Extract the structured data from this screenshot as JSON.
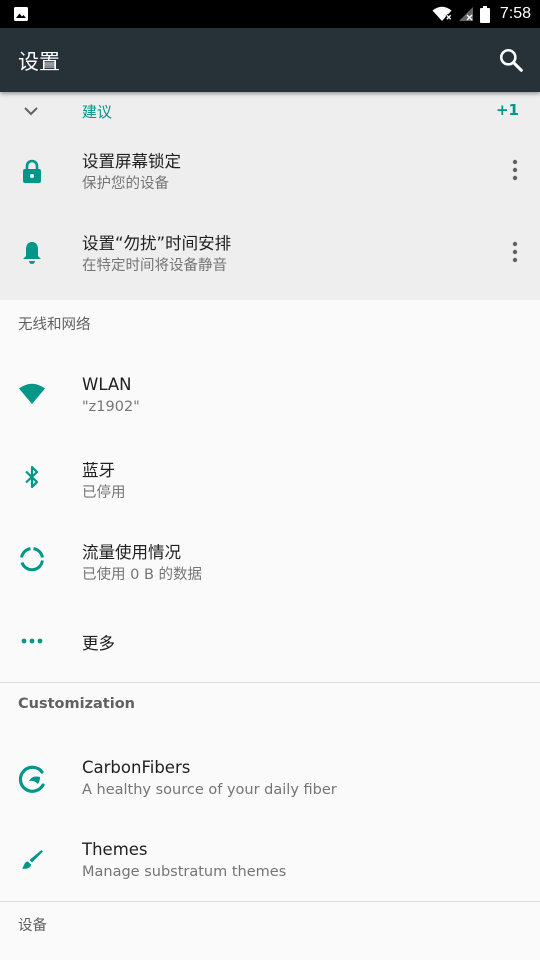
{
  "status_bar": {
    "time": "7:58",
    "icons": [
      "image-icon",
      "wifi-icon",
      "no-signal-icon",
      "battery-icon"
    ]
  },
  "toolbar": {
    "title": "设置",
    "search_icon": "search-icon"
  },
  "suggestions": {
    "label": "建议",
    "count": "+1",
    "items": [
      {
        "title": "设置屏幕锁定",
        "summary": "保护您的设备",
        "icon": "lock-icon"
      },
      {
        "title": "设置“勿扰”时间安排",
        "summary": "在特定时间将设备静音",
        "icon": "bell-icon"
      }
    ]
  },
  "sections": [
    {
      "title": "无线和网络",
      "items": [
        {
          "title": "WLAN",
          "summary": "\"z1902\"",
          "icon": "wifi-icon"
        },
        {
          "title": "蓝牙",
          "summary": "已停用",
          "icon": "bluetooth-icon"
        },
        {
          "title": "流量使用情况",
          "summary": "已使用 0 B 的数据",
          "icon": "data-usage-icon"
        },
        {
          "title": "更多",
          "summary": "",
          "icon": "more-horizontal-icon"
        }
      ]
    },
    {
      "title": "Customization",
      "items": [
        {
          "title": "CarbonFibers",
          "summary": "A healthy source of your daily fiber",
          "icon": "carbonfibers-icon"
        },
        {
          "title": "Themes",
          "summary": "Manage substratum themes",
          "icon": "brush-icon"
        }
      ]
    },
    {
      "title": "设备",
      "items": []
    }
  ],
  "colors": {
    "accent": "#009688",
    "toolbar": "#263238",
    "status_bar": "#000000",
    "suggestion_bg": "#eeeeee",
    "background": "#fafafa"
  }
}
